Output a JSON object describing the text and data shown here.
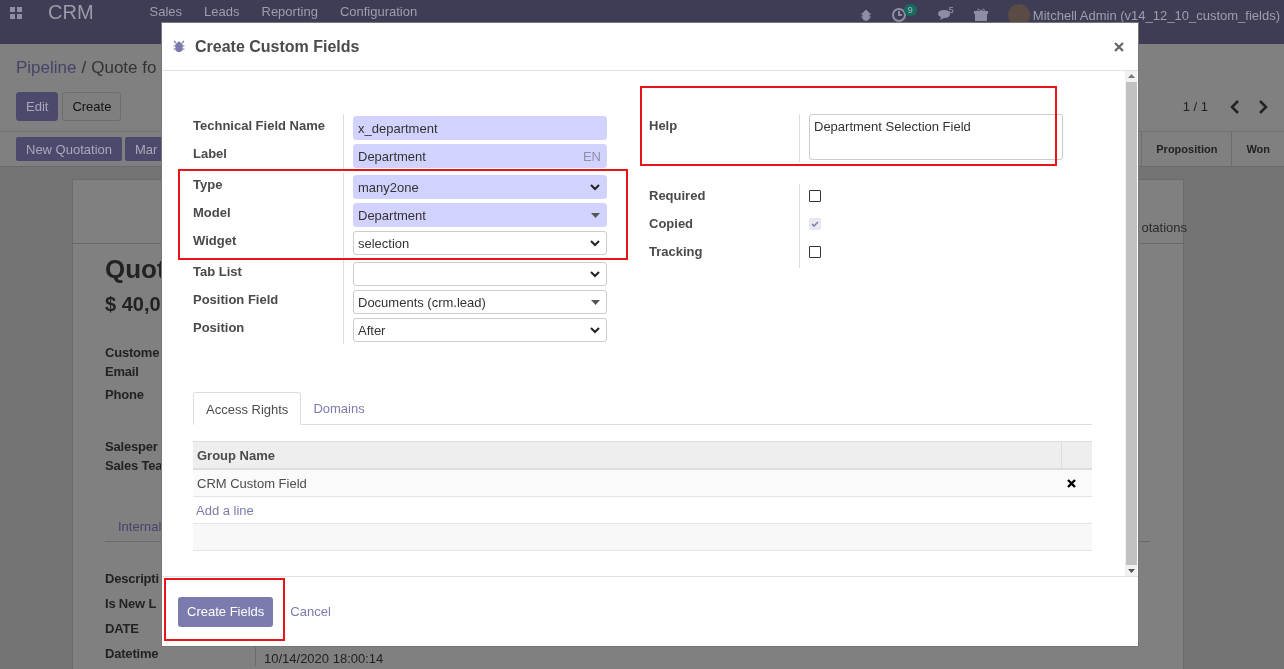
{
  "navbar": {
    "app": "CRM",
    "menu": [
      "Sales",
      "Leads",
      "Reporting",
      "Configuration"
    ],
    "activity_count": "9",
    "message_count": "5",
    "user": "Mitchell Admin (v14_12_10_custom_fields)"
  },
  "control_panel": {
    "breadcrumb": [
      "Pipeline",
      "Quote fo"
    ],
    "separator": "/",
    "pager": "1 / 1",
    "buttons": [
      {
        "label": "Edit",
        "kind": "primary"
      },
      {
        "label": "Create",
        "kind": "secondary"
      }
    ],
    "actions": [
      {
        "label": "New Quotation"
      },
      {
        "label": "Mar"
      }
    ],
    "stages": [
      {
        "label": "Proposition"
      },
      {
        "label": "Won"
      }
    ]
  },
  "record": {
    "tab_right": "otations",
    "title": "Quot",
    "amount": "$ 40,0",
    "label_groups": [
      [
        "Custome",
        "Email",
        "Phone"
      ],
      [
        "Salesper",
        "Sales Tea"
      ]
    ],
    "tabs": [
      "Internal"
    ],
    "fields": [
      {
        "label": "Descripti"
      },
      {
        "label": "Is New L"
      },
      {
        "label": "DATE"
      },
      {
        "label": "Datetime",
        "value": "10/14/2020 18:00:14"
      }
    ]
  },
  "dialog": {
    "title": "Create Custom Fields",
    "fields_left": [
      {
        "label": "Technical Field Name",
        "kind": "text",
        "value": "x_department",
        "required": true,
        "highlighted": false
      },
      {
        "label": "Label",
        "kind": "translatable",
        "value": "Department",
        "lang": "EN",
        "required": true,
        "highlighted": false
      },
      {
        "label": "Type",
        "kind": "select",
        "value": "many2one",
        "required": true,
        "highlighted": true
      },
      {
        "label": "Model",
        "kind": "many2one",
        "value": "Department",
        "required": true,
        "highlighted": true
      },
      {
        "label": "Widget",
        "kind": "select",
        "value": "selection",
        "required": false,
        "highlighted": true
      },
      {
        "label": "Tab List",
        "kind": "select",
        "required": false,
        "highlighted": false
      },
      {
        "label": "Position Field",
        "kind": "many2one",
        "value": "Documents (crm.lead)",
        "required": false,
        "highlighted": false
      },
      {
        "label": "Position",
        "kind": "select",
        "value": "After",
        "required": false,
        "highlighted": false
      }
    ],
    "fields_right": [
      {
        "label": "Help",
        "kind": "textarea",
        "value": "Department Selection Field",
        "highlighted": true
      },
      {
        "label": "Required",
        "kind": "checkbox",
        "checked": false,
        "disabled": false,
        "highlighted": false
      },
      {
        "label": "Copied",
        "kind": "checkbox",
        "checked": true,
        "disabled": true,
        "highlighted": false
      },
      {
        "label": "Tracking",
        "kind": "checkbox",
        "checked": false,
        "disabled": false,
        "highlighted": false
      }
    ],
    "tabs": [
      {
        "label": "Access Rights",
        "selected": true
      },
      {
        "label": "Domains",
        "selected": false
      }
    ],
    "table": {
      "columns": [
        "Group Name"
      ],
      "rows": [
        {
          "cells": [
            "CRM Custom Field"
          ]
        }
      ],
      "add_line": "Add a line"
    },
    "buttons": [
      {
        "label": "Create Fields",
        "kind": "primary",
        "highlighted": true
      },
      {
        "label": "Cancel",
        "kind": "link",
        "highlighted": false
      }
    ]
  }
}
